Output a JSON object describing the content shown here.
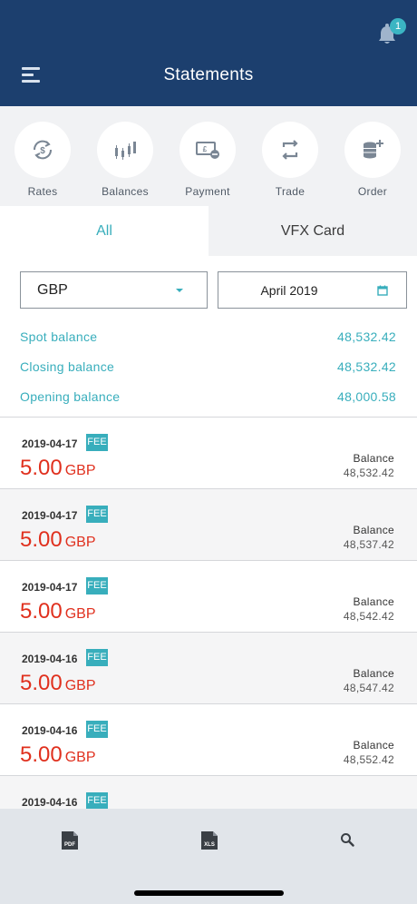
{
  "header": {
    "title": "Statements",
    "notification_count": "1"
  },
  "quick_actions": [
    {
      "label": "Rates",
      "icon": "rates-icon"
    },
    {
      "label": "Balances",
      "icon": "balances-icon"
    },
    {
      "label": "Payment",
      "icon": "payment-icon"
    },
    {
      "label": "Trade",
      "icon": "trade-icon"
    },
    {
      "label": "Order",
      "icon": "order-icon"
    }
  ],
  "tabs": [
    {
      "label": "All",
      "active": true
    },
    {
      "label": "VFX Card",
      "active": false
    }
  ],
  "filters": {
    "currency": "GBP",
    "month": "April 2019"
  },
  "summary": [
    {
      "label": "Spot balance",
      "value": "48,532.42"
    },
    {
      "label": "Closing balance",
      "value": "48,532.42"
    },
    {
      "label": "Opening balance",
      "value": "48,000.58"
    }
  ],
  "transactions": [
    {
      "date": "2019-04-17",
      "tag": "FEE",
      "amount": "5.00",
      "currency": "GBP",
      "balance_label": "Balance",
      "balance": "48,532.42"
    },
    {
      "date": "2019-04-17",
      "tag": "FEE",
      "amount": "5.00",
      "currency": "GBP",
      "balance_label": "Balance",
      "balance": "48,537.42"
    },
    {
      "date": "2019-04-17",
      "tag": "FEE",
      "amount": "5.00",
      "currency": "GBP",
      "balance_label": "Balance",
      "balance": "48,542.42"
    },
    {
      "date": "2019-04-16",
      "tag": "FEE",
      "amount": "5.00",
      "currency": "GBP",
      "balance_label": "Balance",
      "balance": "48,547.42"
    },
    {
      "date": "2019-04-16",
      "tag": "FEE",
      "amount": "5.00",
      "currency": "GBP",
      "balance_label": "Balance",
      "balance": "48,552.42"
    },
    {
      "date": "2019-04-16",
      "tag": "FEE",
      "amount": "",
      "currency": "",
      "balance_label": "",
      "balance": ""
    }
  ],
  "bottom_bar": {
    "pdf_label": "PDF",
    "xls_label": "XLS",
    "search_icon": "search-icon"
  },
  "colors": {
    "header_bg": "#1c3f6e",
    "accent": "#38aebc",
    "amount_red": "#e0301e",
    "bottom_bar_bg": "#e1e5ea"
  }
}
